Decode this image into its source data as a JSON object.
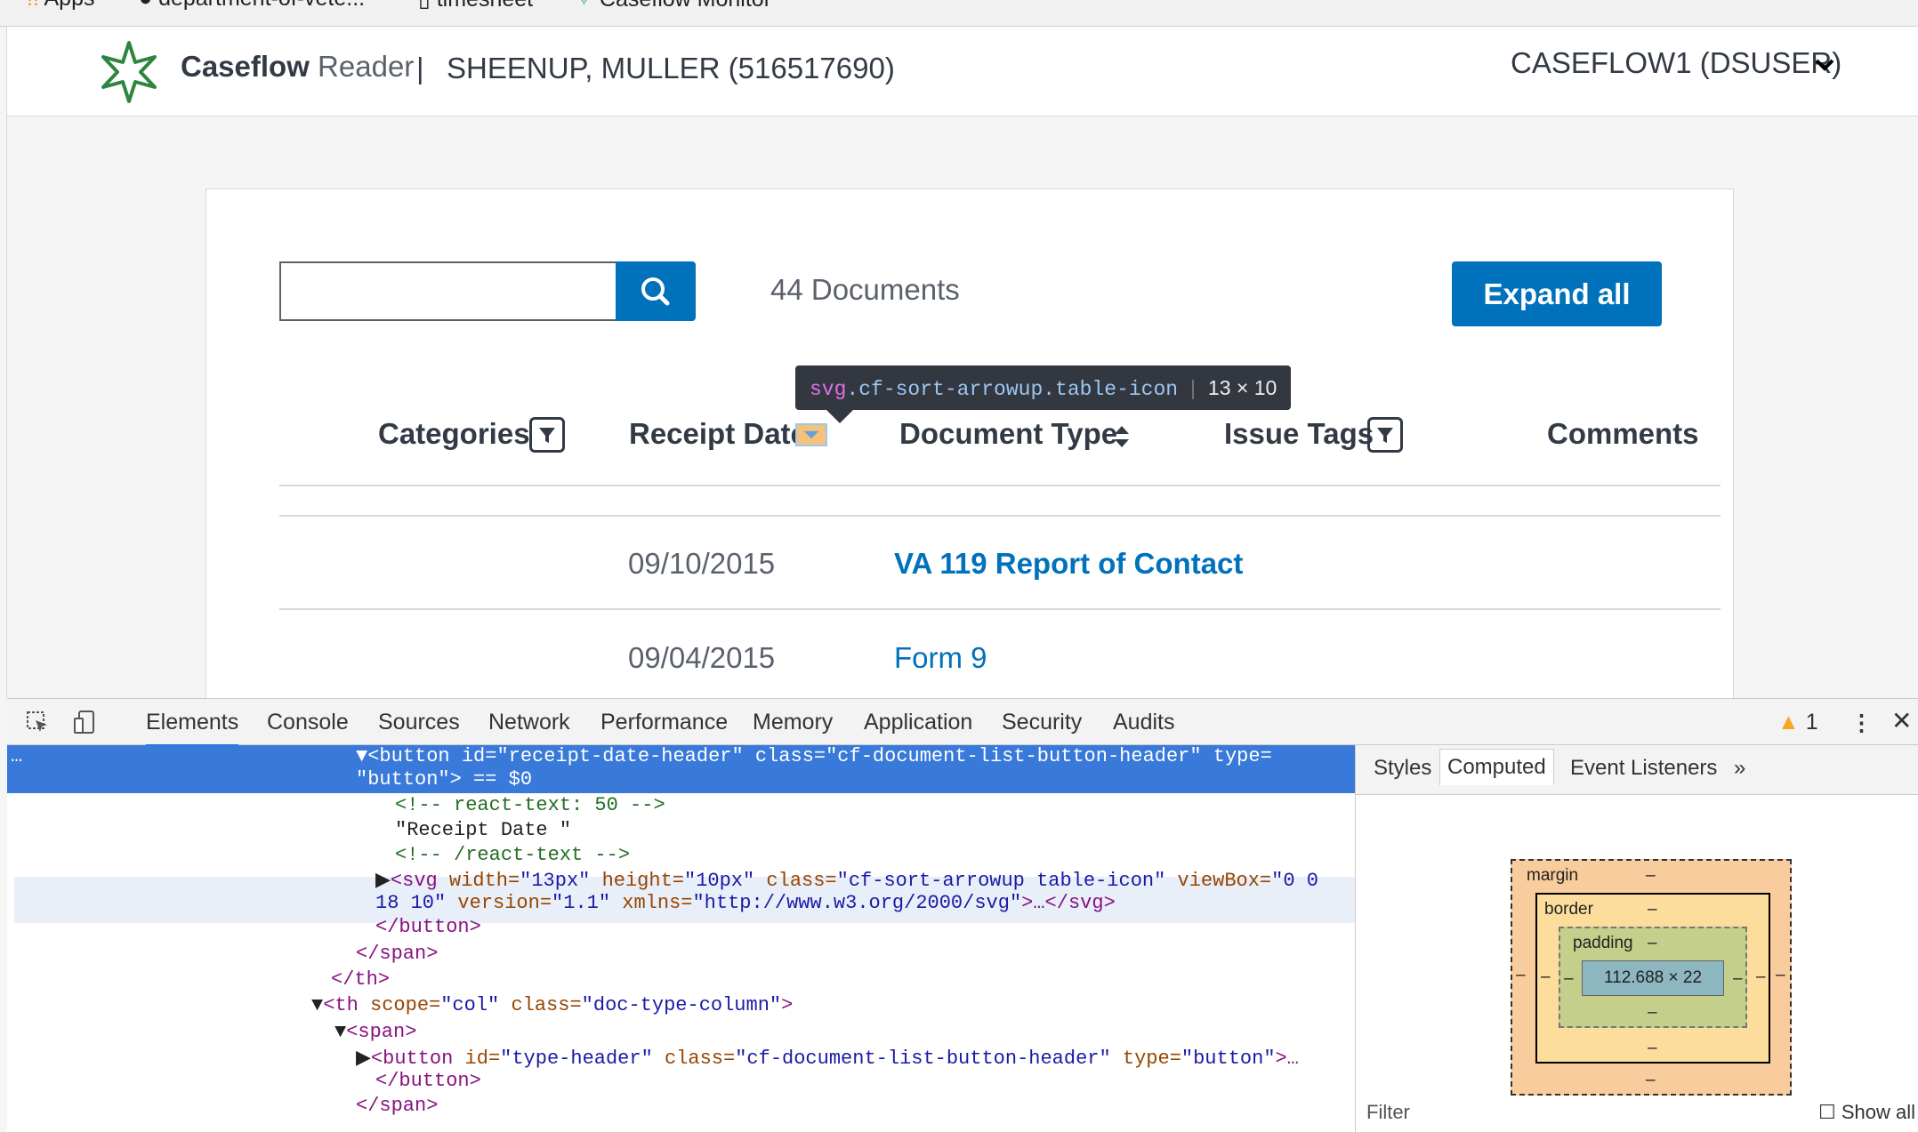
{
  "bookmarks": {
    "items": [
      "Apps",
      "department-of-vete...",
      "timesheet",
      "Caseflow Monitor"
    ]
  },
  "header": {
    "app_name_bold": "Caseflow",
    "app_name_light": "Reader",
    "separator": "|",
    "veteran": "SHEENUP, MULLER (516517690)",
    "user": "CASEFLOW1 (DSUSER)"
  },
  "search": {
    "value": "",
    "placeholder": ""
  },
  "documents": {
    "count_label": "44 Documents",
    "expand_all_label": "Expand all",
    "columns": [
      "Categories",
      "Receipt Date",
      "Document Type",
      "Issue Tags",
      "Comments"
    ],
    "rows": [
      {
        "date": "09/10/2015",
        "type": "VA 119 Report of Contact"
      },
      {
        "date": "09/04/2015",
        "type": "Form 9"
      }
    ]
  },
  "inspector_tooltip": {
    "tag": "svg",
    "classes": ".cf-sort-arrowup.table-icon",
    "dims": "13 × 10"
  },
  "devtools": {
    "tabs": [
      "Elements",
      "Console",
      "Sources",
      "Network",
      "Performance",
      "Memory",
      "Application",
      "Security",
      "Audits"
    ],
    "warning_count": "1",
    "dom": {
      "l1_tag": "<button",
      "l1_id_attr": " id=",
      "l1_id_val": "\"receipt-date-header\"",
      "l1_class_attr": " class=",
      "l1_class_val": "\"cf-document-list-button-header\"",
      "l1_type_attr": " type=",
      "l2_val": "\"button\"",
      "l2_rest": "> == $0",
      "l3": "<!-- react-text: 50 -->",
      "l4": "\"Receipt Date \"",
      "l5": "<!-- /react-text -->",
      "l6_tag": "<svg",
      "l6_width": " width=",
      "l6_width_val": "\"13px\"",
      "l6_height": " height=",
      "l6_height_val": "\"10px\"",
      "l6_class": " class=",
      "l6_class_val": "\"cf-sort-arrowup table-icon\"",
      "l6_viewbox": " viewBox=",
      "l6_viewbox_val": "\"0 0",
      "l7_viewbox_val": "18 10\"",
      "l7_version": " version=",
      "l7_version_val": "\"1.1\"",
      "l7_xmlns": " xmlns=",
      "l7_xmlns_val": "\"http://www.w3.org/2000/svg\"",
      "l7_rest": ">…</svg>",
      "l8": "</button>",
      "l9": "</span>",
      "l10": "</th>",
      "l11_tag": "<th",
      "l11_scope": " scope=",
      "l11_scope_val": "\"col\"",
      "l11_class": " class=",
      "l11_class_val": "\"doc-type-column\"",
      "l11_end": ">",
      "l12": "<span>",
      "l13_tag": "<button",
      "l13_id": " id=",
      "l13_id_val": "\"type-header\"",
      "l13_class": " class=",
      "l13_class_val": "\"cf-document-list-button-header\"",
      "l13_type": " type=",
      "l13_type_val": "\"button\"",
      "l13_end": ">…",
      "l14": "</button>",
      "l15": "</span>"
    },
    "side_tabs": [
      "Styles",
      "Computed",
      "Event Listeners"
    ],
    "box_model": {
      "margin": "margin",
      "border": "border",
      "padding": "padding",
      "dash": "–",
      "content": "112.688 × 22"
    },
    "filter": "Filter",
    "show_all": "Show all"
  },
  "colors": {
    "primary": "#0071bb",
    "text": "#323a45",
    "muted": "#5b616b",
    "logo": "#2e8540"
  }
}
